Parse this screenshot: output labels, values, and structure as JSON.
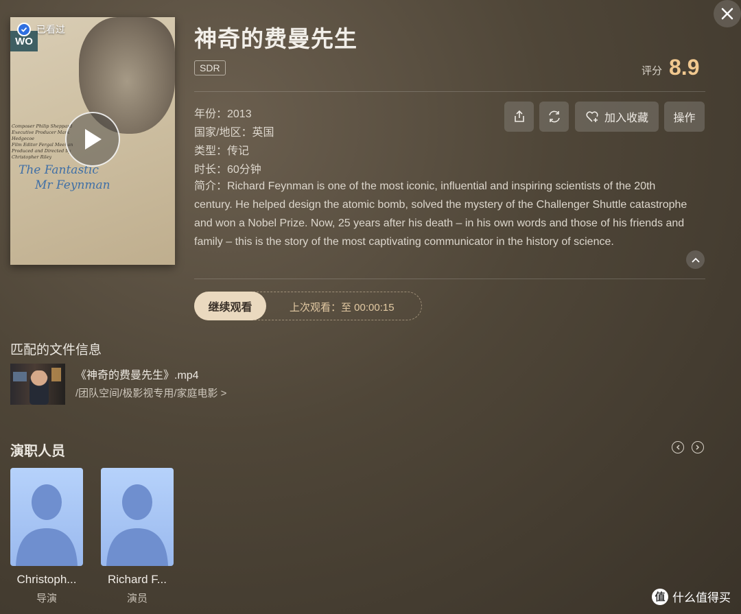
{
  "close": {
    "icon": "close-icon"
  },
  "poster": {
    "badge": "WO",
    "watched_label": "已看过",
    "title_line1": "The Fantastic",
    "title_line2": "Mr Feynman",
    "credits": [
      "Composer Philip Sheppard",
      "Executive Producer Mark Hedgecoe",
      "Film Editor Fergal Meehan",
      "Produced and Directed by Christopher Riley"
    ]
  },
  "header": {
    "title": "神奇的费曼先生",
    "quality": "SDR",
    "rating_label": "评分",
    "rating_value": "8.9"
  },
  "meta": {
    "year": "年份：2013",
    "region": "国家/地区：英国",
    "genre": "类型：传记",
    "duration": "时长：60分钟",
    "summary": "简介：Richard Feynman is one of the most iconic, influential and inspiring scientists of the 20th century. He helped design the atomic bomb, solved the mystery of the Challenger Shuttle catastrophe and won a Nobel Prize. Now, 25 years after his death – in his own words and those of his friends and family – this is the story of the most captivating communicator in the history of science."
  },
  "actions": {
    "favorite_label": "加入收藏",
    "more_label": "操作"
  },
  "playback": {
    "continue_label": "继续观看",
    "last_watch": "上次观看：至 00:00:15"
  },
  "file_section": {
    "title": "匹配的文件信息",
    "file_name": "《神奇的费曼先生》.mp4",
    "file_path": "/团队空间/极影视专用/家庭电影 >"
  },
  "cast_section": {
    "title": "演职人员",
    "people": [
      {
        "name": "Christoph...",
        "role": "导演"
      },
      {
        "name": "Richard F...",
        "role": "演员"
      }
    ]
  },
  "watermark": {
    "text": "什么值得买",
    "glyph": "值"
  },
  "colors": {
    "accent": "#f0c88f",
    "continue_bg": "#ead9bf",
    "watched_blue": "#2f6fe0"
  }
}
